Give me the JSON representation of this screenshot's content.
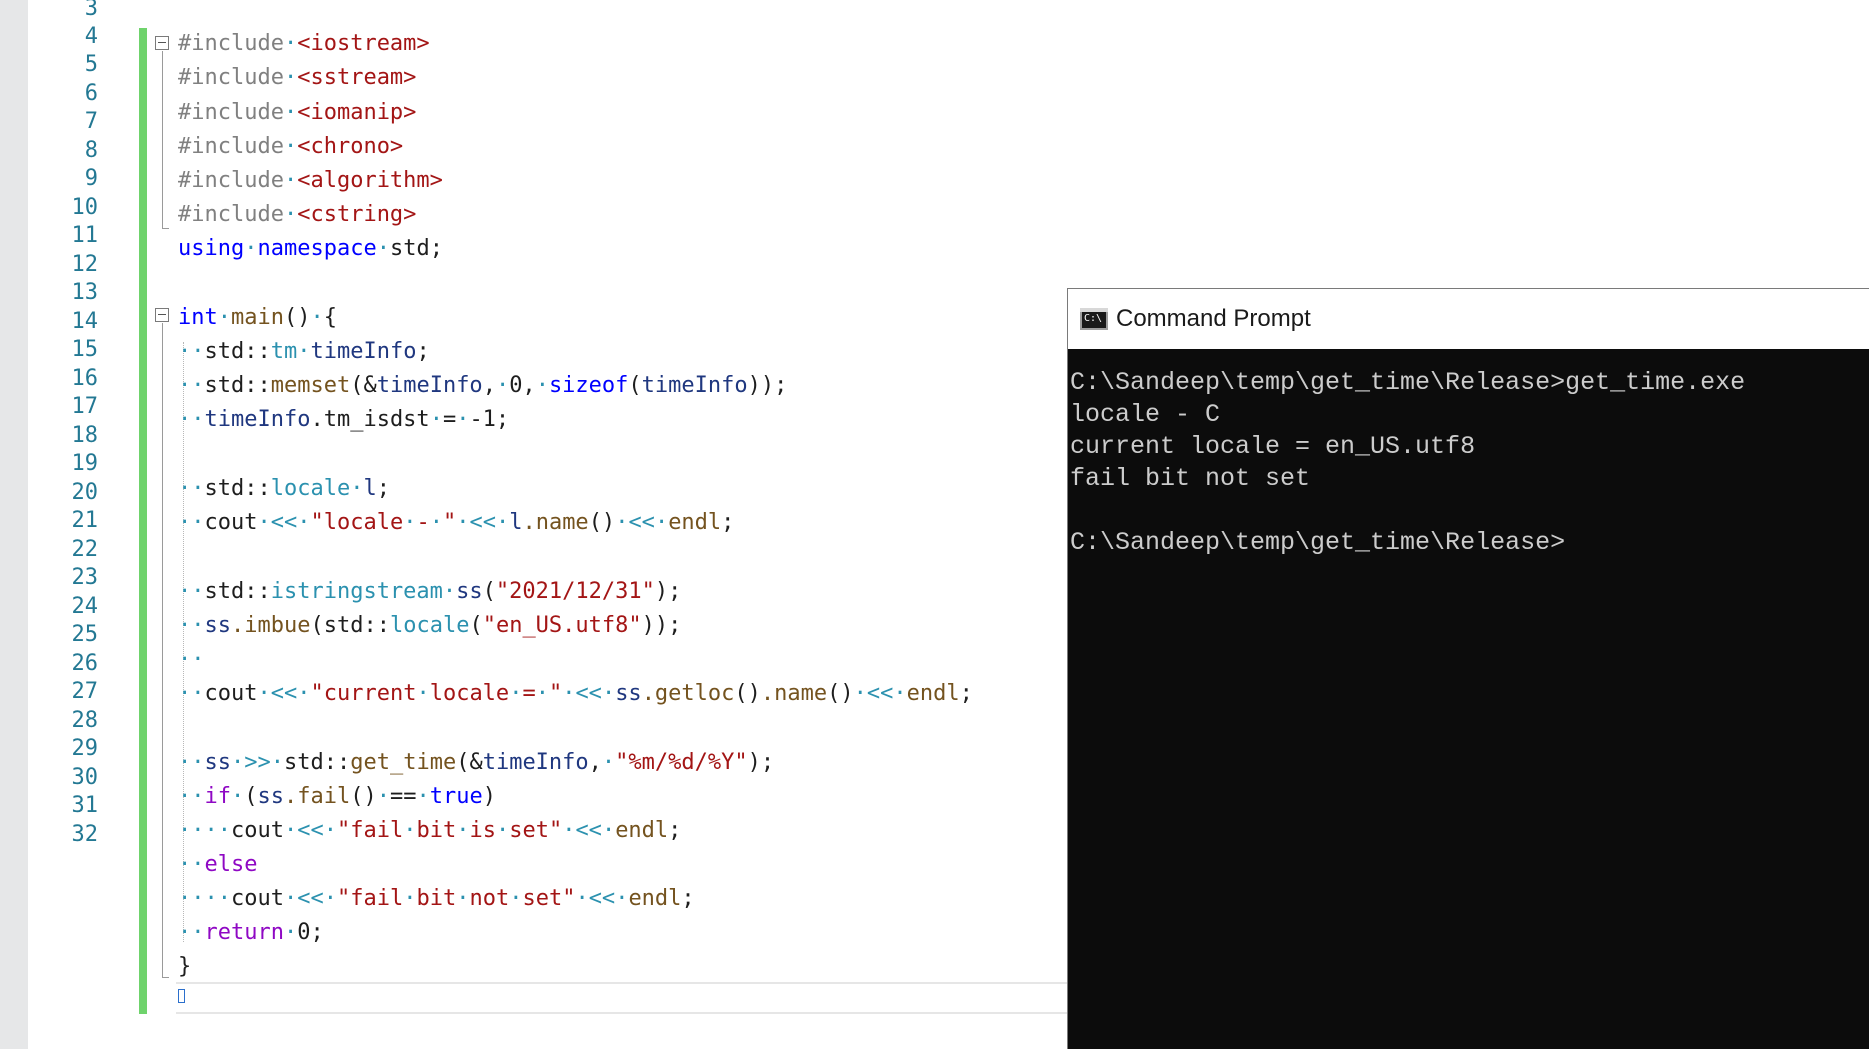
{
  "editor": {
    "line_numbers": [
      "3",
      "4",
      "5",
      "6",
      "7",
      "8",
      "9",
      "10",
      "11",
      "12",
      "13",
      "14",
      "15",
      "16",
      "17",
      "18",
      "19",
      "20",
      "21",
      "22",
      "23",
      "24",
      "25",
      "26",
      "27",
      "28",
      "29",
      "30",
      "31",
      "32"
    ],
    "code": {
      "l4_pp": "#include",
      "l4_inc": "<iostream>",
      "l5_pp": "#include",
      "l5_inc": "<sstream>",
      "l6_pp": "#include",
      "l6_inc": "<iomanip>",
      "l7_pp": "#include",
      "l7_inc": "<chrono>",
      "l8_pp": "#include",
      "l8_inc": "<algorithm>",
      "l9_pp": "#include",
      "l9_inc": "<cstring>",
      "l10_kw1": "using",
      "l10_kw2": "namespace",
      "l10_rest": "std;",
      "l12_kw": "int",
      "l12_fn": "main",
      "l12_rest": "()",
      "l12_brace": "{",
      "l13_ns": "std::",
      "l13_ty": "tm",
      "l13_var": "timeInfo",
      "l13_end": ";",
      "l14_ns": "std::",
      "l14_fn": "memset",
      "l14_p1": "(&",
      "l14_var": "timeInfo",
      "l14_p2": ",",
      "l14_num": "0,",
      "l14_kw": "sizeof",
      "l14_p3": "(",
      "l14_var2": "timeInfo",
      "l14_end": "));",
      "l15_var": "timeInfo",
      "l15_rest": ".tm_isdst",
      "l15_op": "=",
      "l15_val": "-1;",
      "l17_ns": "std::",
      "l17_ty": "locale",
      "l17_var": "l",
      "l17_end": ";",
      "l18_a": "cout",
      "l18_op1": "<<",
      "l18_str": "\"locale",
      "l18_str2": "-",
      "l18_str3": "\"",
      "l18_op2": "<<",
      "l18_var": "l",
      "l18_fn": ".name",
      "l18_p": "()",
      "l18_op3": "<<",
      "l18_end": "endl",
      "l18_semi": ";",
      "l20_ns": "std::",
      "l20_ty": "istringstream",
      "l20_var": "ss",
      "l20_p": "(",
      "l20_str": "\"2021/12/31\"",
      "l20_end": ");",
      "l21_var": "ss",
      "l21_fn": ".imbue",
      "l21_p": "(std::",
      "l21_ty": "locale",
      "l21_p2": "(",
      "l21_str": "\"en_US.utf8\"",
      "l21_end": "));",
      "l23_a": "cout",
      "l23_op1": "<<",
      "l23_str1": "\"current",
      "l23_str2": "locale",
      "l23_str3": "=",
      "l23_str4": "\"",
      "l23_op2": "<<",
      "l23_var": "ss",
      "l23_fn1": ".getloc",
      "l23_p1": "()",
      "l23_fn2": ".name",
      "l23_p2": "()",
      "l23_op3": "<<",
      "l23_end": "endl",
      "l23_semi": ";",
      "l25_var": "ss",
      "l25_op": ">>",
      "l25_ns": "std::",
      "l25_fn": "get_time",
      "l25_p1": "(&",
      "l25_var2": "timeInfo",
      "l25_p2": ",",
      "l25_str": "\"%m/%d/%Y\"",
      "l25_end": ");",
      "l26_kw": "if",
      "l26_p": "(",
      "l26_var": "ss",
      "l26_fn": ".fail",
      "l26_p2": "()",
      "l26_op": "==",
      "l26_kw2": "true",
      "l26_end": ")",
      "l27_a": "cout",
      "l27_op1": "<<",
      "l27_str1": "\"fail",
      "l27_str2": "bit",
      "l27_str3": "is",
      "l27_str4": "set\"",
      "l27_op2": "<<",
      "l27_end": "endl",
      "l27_semi": ";",
      "l28_kw": "else",
      "l29_a": "cout",
      "l29_op1": "<<",
      "l29_str1": "\"fail",
      "l29_str2": "bit",
      "l29_str3": "not",
      "l29_str4": "set\"",
      "l29_op2": "<<",
      "l29_end": "endl",
      "l29_semi": ";",
      "l30_kw": "return",
      "l30_val": "0;",
      "l31_brace": "}"
    }
  },
  "cmd": {
    "title": "Command Prompt",
    "icon_label": "C:\\",
    "icon_name": "cmd-icon",
    "output": [
      "C:\\Sandeep\\temp\\get_time\\Release>get_time.exe",
      "locale - C",
      "current locale = en_US.utf8",
      "fail bit not set",
      "",
      "C:\\Sandeep\\temp\\get_time\\Release>"
    ]
  },
  "colors": {
    "keyword": "#0000ff",
    "type": "#2b91af",
    "string": "#a31515",
    "preprocessor": "#808080",
    "function": "#74531f",
    "variable": "#1f377f",
    "control": "#8f08c4",
    "change_bar": "#6fd36c",
    "console_bg": "#0c0c0c",
    "console_text": "#cccccc"
  }
}
